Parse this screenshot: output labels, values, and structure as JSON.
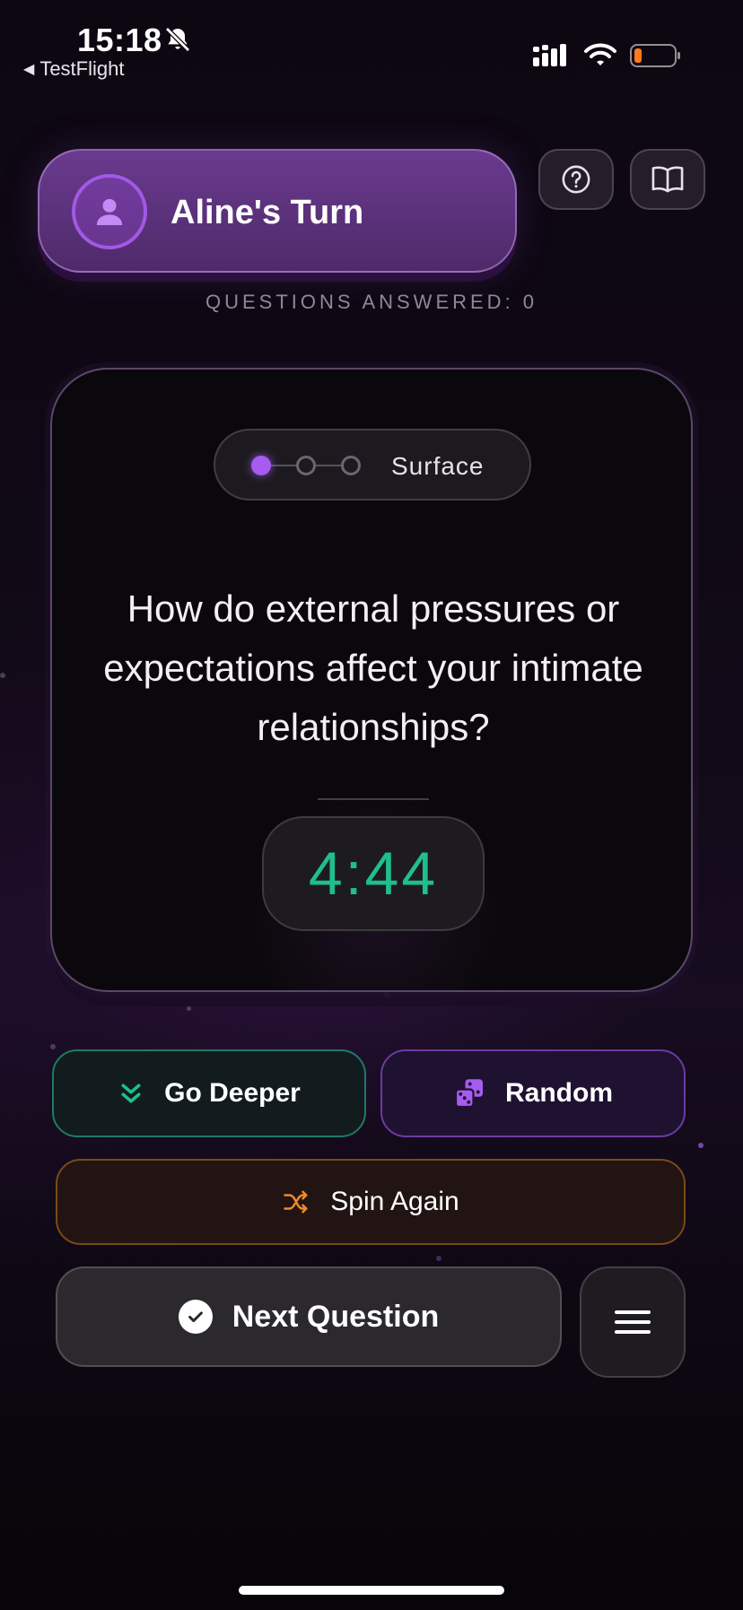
{
  "status_bar": {
    "time": "15:18",
    "back_label": "TestFlight",
    "icons": [
      "bell-slash-icon",
      "signal-icon",
      "wifi-icon",
      "battery-icon"
    ],
    "battery_color": "#ff7a1a"
  },
  "header": {
    "player_turn": "Aline's Turn",
    "avatar_icon": "user-icon",
    "help_icon": "question-circle-icon",
    "book_icon": "open-book-icon",
    "questions_answered_label": "QUESTIONS ANSWERED: 0"
  },
  "card": {
    "depth_label": "Surface",
    "depth_levels_total": 3,
    "depth_level_active": 1,
    "question": "How do external pressures or expectations affect your intimate relationships?",
    "timer": "4:44",
    "timer_color": "#1fbf8a"
  },
  "actions": {
    "go_deeper_label": "Go Deeper",
    "random_label": "Random",
    "spin_again_label": "Spin Again",
    "next_question_label": "Next Question",
    "menu_icon": "hamburger-menu-icon"
  },
  "colors": {
    "accent_purple": "#a65cf0",
    "teal": "#1fbf8a",
    "orange": "#f08a2a"
  }
}
